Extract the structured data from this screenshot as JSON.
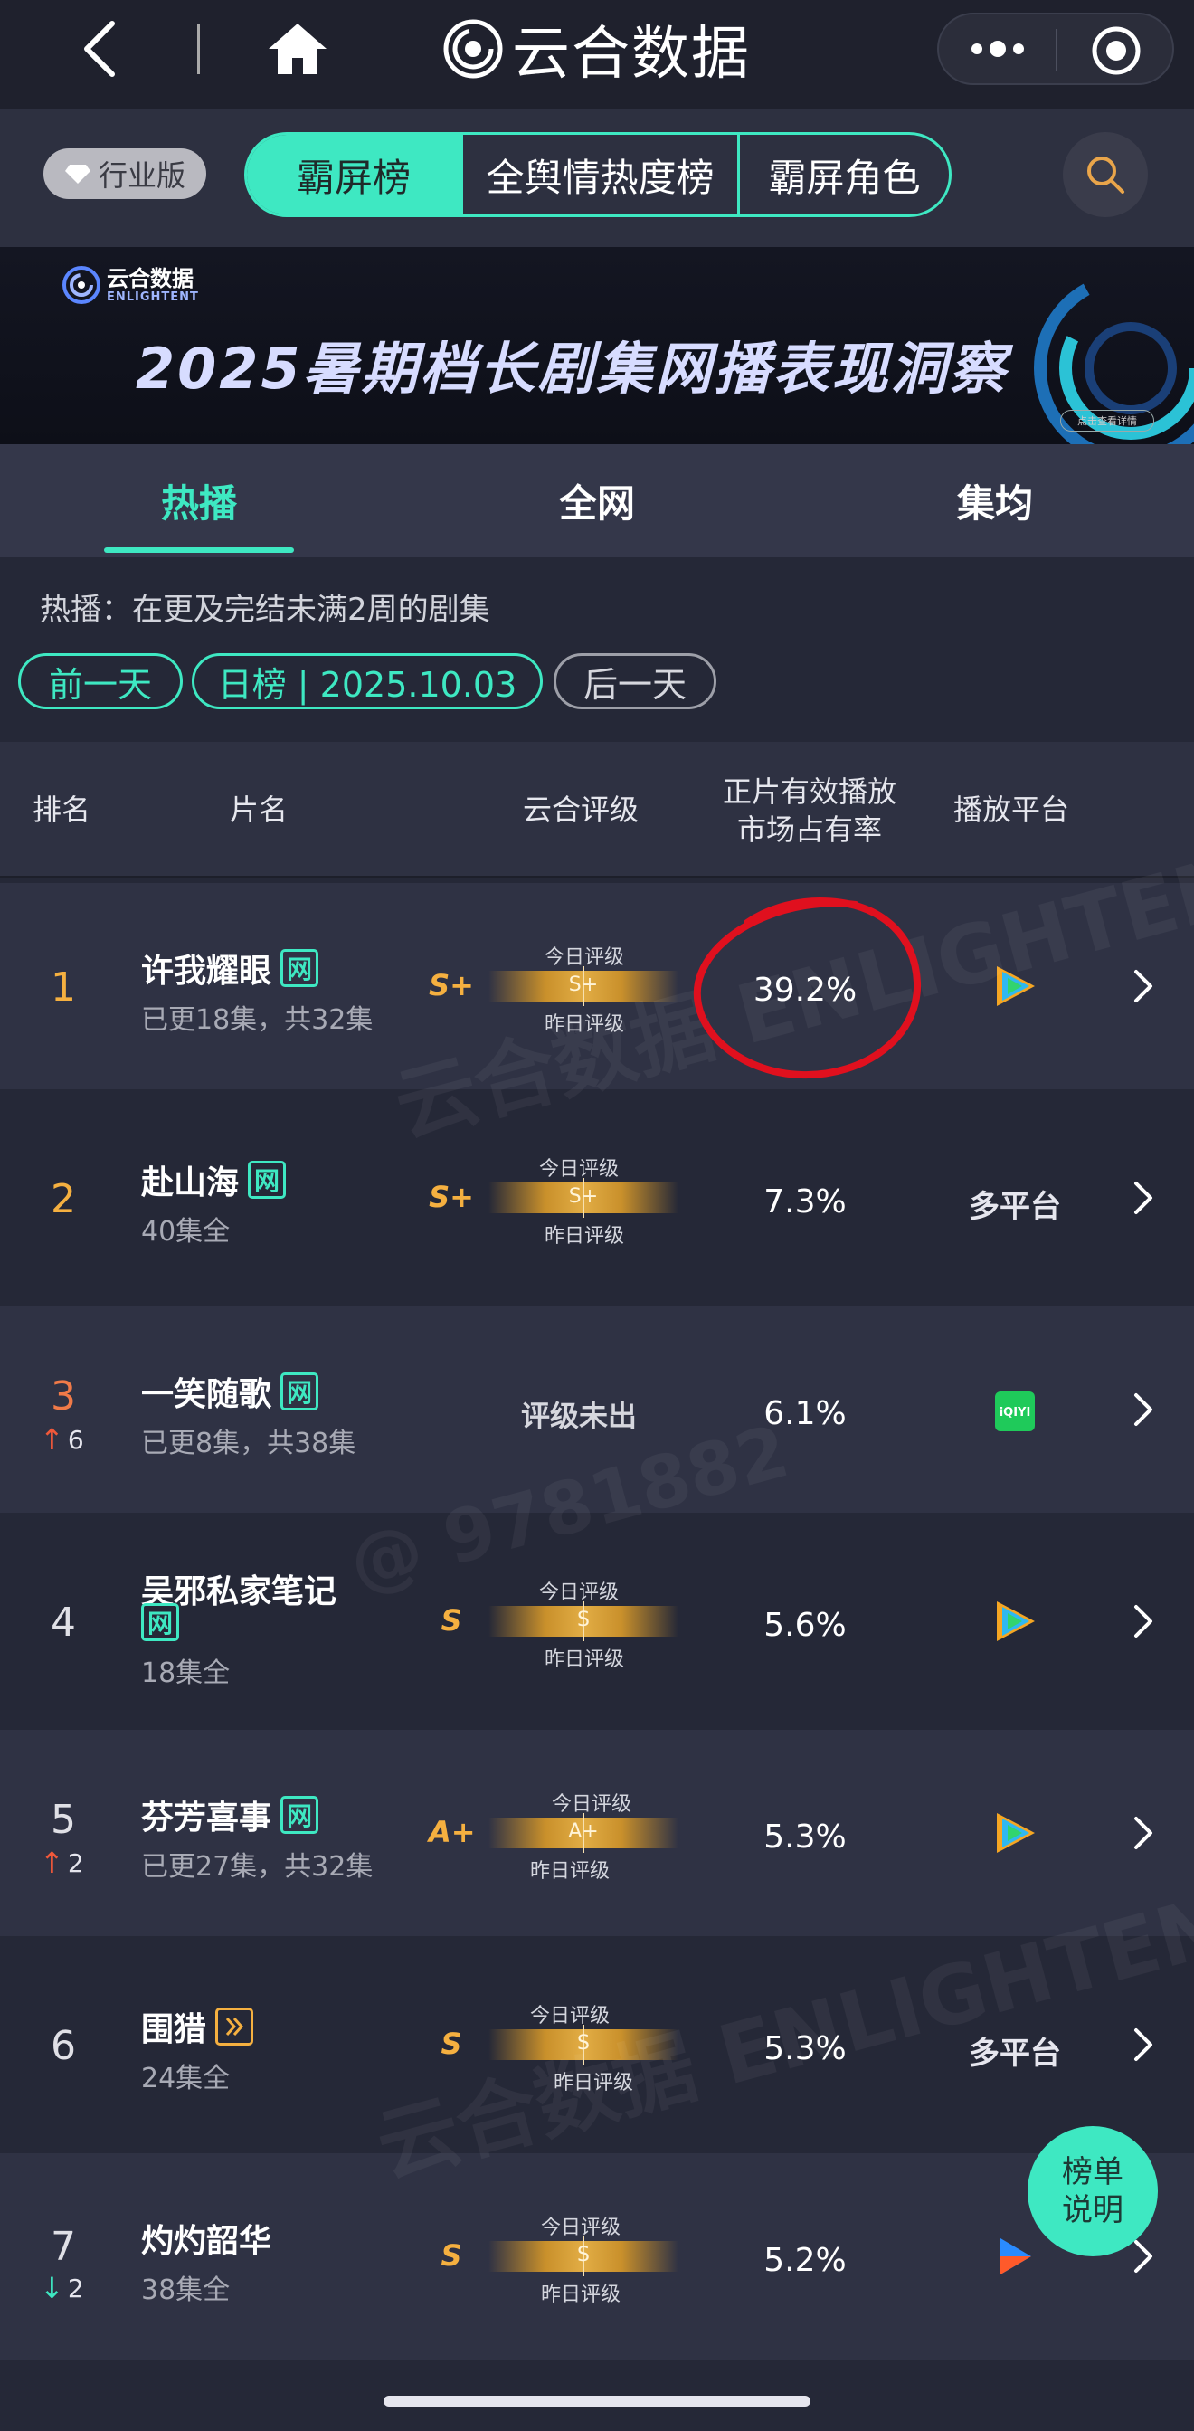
{
  "nav": {
    "title": "云合数据",
    "icons": [
      "back-icon",
      "home-icon",
      "more-icon",
      "close-icon"
    ]
  },
  "tabs": {
    "edition": "行业版",
    "segments": [
      "霸屏榜",
      "全舆情热度榜",
      "霸屏角色"
    ],
    "active": 0
  },
  "banner": {
    "logo_cn": "云合数据",
    "logo_en": "ENLIGHTENT",
    "title": "2025暑期档长剧集网播表现洞察",
    "tag": "点击查看详情"
  },
  "subtabs": [
    "热播",
    "全网",
    "集均"
  ],
  "desc": "热播：在更及完结未满2周的剧集",
  "date": {
    "prev": "前一天",
    "current": "日榜 | 2025.10.03",
    "next": "后一天"
  },
  "table": {
    "headers": {
      "rank": "排名",
      "name": "片名",
      "rating": "云合评级",
      "share_line1": "正片有效播放",
      "share_line2": "市场占有率",
      "platform": "播放平台"
    },
    "gauge_today": "今日评级",
    "gauge_yesterday": "昨日评级",
    "rows": [
      {
        "rank": "1",
        "trend": "",
        "title": "许我耀眼",
        "badge": "网",
        "episodes": "已更18集，共32集",
        "grade": "S+",
        "gauge": "S+",
        "share": "39.2%",
        "platform": "",
        "platform_icon": "tencent-video-icon"
      },
      {
        "rank": "2",
        "trend": "",
        "title": "赴山海",
        "badge": "网",
        "episodes": "40集全",
        "grade": "S+",
        "gauge": "S+",
        "share": "7.3%",
        "platform": "多平台",
        "platform_icon": ""
      },
      {
        "rank": "3",
        "trend": "6",
        "title": "一笑随歌",
        "badge": "网",
        "episodes": "已更8集，共38集",
        "grade": "",
        "gauge": "",
        "no_grade": "评级未出",
        "share": "6.1%",
        "platform": "",
        "platform_icon": "iqiyi-icon"
      },
      {
        "rank": "4",
        "trend": "",
        "title": "吴邪私家笔记",
        "badge": "网",
        "episodes": "18集全",
        "grade": "S",
        "gauge": "S",
        "share": "5.6%",
        "platform": "",
        "platform_icon": "tencent-video-icon"
      },
      {
        "rank": "5",
        "trend": "2",
        "title": "芬芳喜事",
        "badge": "网",
        "episodes": "已更27集，共32集",
        "grade": "A+",
        "gauge": "A+",
        "share": "5.3%",
        "platform": "",
        "platform_icon": "tencent-video-icon"
      },
      {
        "rank": "6",
        "trend": "",
        "title": "围猎",
        "badge": "",
        "episodes": "24集全",
        "grade": "S",
        "gauge": "S",
        "share": "5.3%",
        "platform": "多平台",
        "platform_icon": ""
      },
      {
        "rank": "7",
        "trend": "2",
        "title": "灼灼韶华",
        "badge": "",
        "episodes": "38集全",
        "grade": "S",
        "gauge": "S",
        "share": "5.2%",
        "platform": "",
        "platform_icon": "youku-icon"
      }
    ]
  },
  "help": {
    "line1": "榜单",
    "line2": "说明"
  },
  "watermark": "云合数据 ENLIGHTENT",
  "user_watermark": "@ 9781882",
  "colors": {
    "accent": "#3ee8c2",
    "gold": "#f5b040",
    "annotation": "#e0101e"
  }
}
